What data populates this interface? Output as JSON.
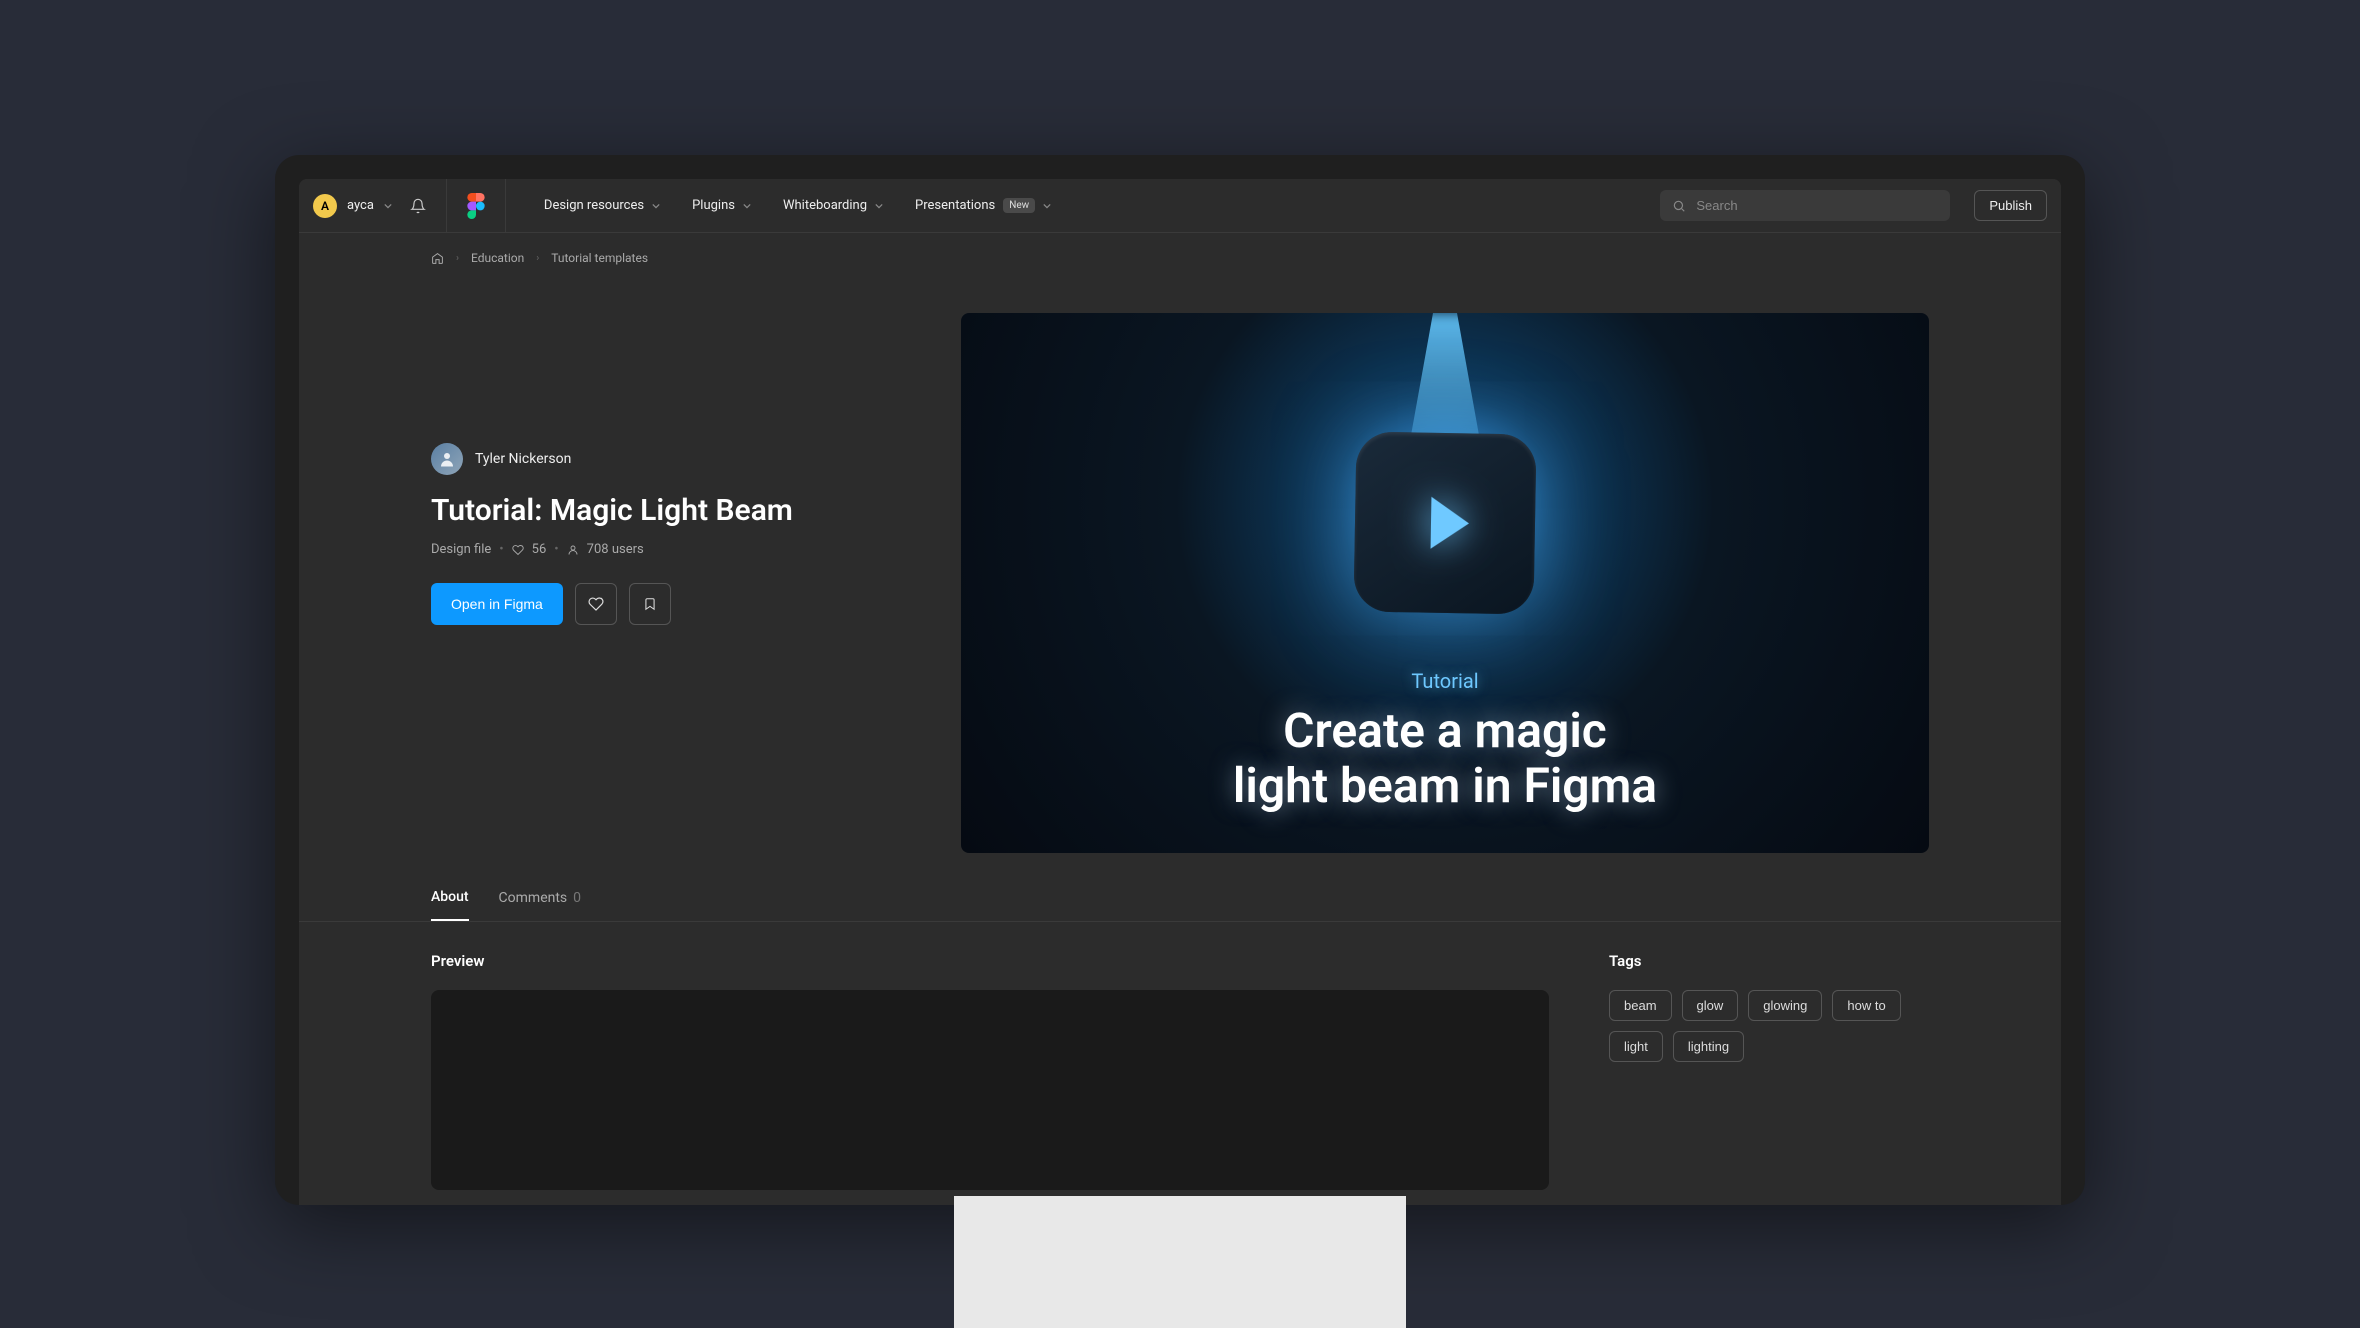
{
  "header": {
    "user_initial": "A",
    "user_name": "ayca",
    "nav": [
      {
        "label": "Design resources",
        "has_dropdown": true
      },
      {
        "label": "Plugins",
        "has_dropdown": true
      },
      {
        "label": "Whiteboarding",
        "has_dropdown": true
      },
      {
        "label": "Presentations",
        "has_dropdown": true,
        "badge": "New"
      }
    ],
    "search_placeholder": "Search",
    "publish_label": "Publish"
  },
  "breadcrumb": {
    "items": [
      "Education",
      "Tutorial templates"
    ]
  },
  "resource": {
    "author": "Tyler Nickerson",
    "title": "Tutorial: Magic Light Beam",
    "file_type": "Design file",
    "likes": "56",
    "users": "708 users",
    "open_label": "Open in Figma"
  },
  "hero": {
    "kicker": "Tutorial",
    "headline_line1": "Create a magic",
    "headline_line2": "light beam in Figma"
  },
  "tabs": {
    "about": "About",
    "comments": "Comments",
    "comments_count": "0"
  },
  "sections": {
    "preview": "Preview",
    "tags": "Tags"
  },
  "tags": [
    "beam",
    "glow",
    "glowing",
    "how to",
    "light",
    "lighting"
  ]
}
